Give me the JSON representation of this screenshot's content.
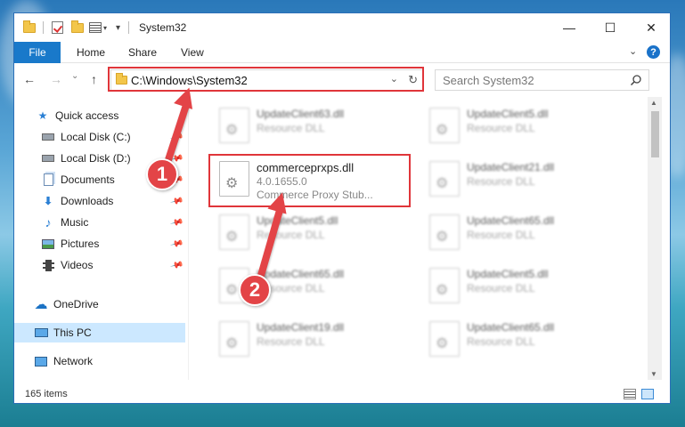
{
  "window": {
    "title": "System32",
    "controls": {
      "minimize": "—",
      "maximize": "☐",
      "close": "✕"
    }
  },
  "ribbon": {
    "tabs": [
      "File",
      "Home",
      "Share",
      "View"
    ],
    "expand_icon": "chevron-down-icon",
    "help_icon": "?"
  },
  "navigation": {
    "back": "←",
    "forward": "→",
    "recent": "⌄",
    "up": "↑",
    "address": "C:\\Windows\\System32",
    "search_placeholder": "Search System32"
  },
  "sidebar": {
    "items": [
      {
        "label": "Quick access",
        "icon": "star-icon",
        "pinned": false
      },
      {
        "label": "Local Disk (C:)",
        "icon": "drive-icon",
        "pinned": true
      },
      {
        "label": "Local Disk (D:)",
        "icon": "drive-icon",
        "pinned": true
      },
      {
        "label": "Documents",
        "icon": "documents-icon",
        "pinned": true
      },
      {
        "label": "Downloads",
        "icon": "download-icon",
        "pinned": true
      },
      {
        "label": "Music",
        "icon": "music-icon",
        "pinned": true
      },
      {
        "label": "Pictures",
        "icon": "pictures-icon",
        "pinned": true
      },
      {
        "label": "Videos",
        "icon": "videos-icon",
        "pinned": true
      },
      {
        "label": "OneDrive",
        "icon": "cloud-icon",
        "pinned": false
      },
      {
        "label": "This PC",
        "icon": "computer-icon",
        "pinned": false,
        "selected": true
      },
      {
        "label": "Network",
        "icon": "network-icon",
        "pinned": false
      }
    ]
  },
  "files": [
    {
      "name": "UpdateClient63.dll",
      "line2": "Resource DLL"
    },
    {
      "name": "UpdateClient5.dll",
      "line2": "Resource DLL"
    },
    {
      "name": "commerceprxps.dll",
      "line2": "4.0.1655.0",
      "line3": "Commerce Proxy Stub...",
      "highlighted": true
    },
    {
      "name": "UpdateClient21.dll",
      "line2": "Resource DLL"
    },
    {
      "name": "UpdateClient5.dll",
      "line2": "Resource DLL"
    },
    {
      "name": "UpdateClient65.dll",
      "line2": "Resource DLL"
    },
    {
      "name": "UpdateClient65.dll",
      "line2": "Resource DLL"
    },
    {
      "name": "UpdateClient5.dll",
      "line2": "Resource DLL"
    },
    {
      "name": "UpdateClient19.dll",
      "line2": "Resource DLL"
    },
    {
      "name": "UpdateClient65.dll",
      "line2": "Resource DLL"
    }
  ],
  "status": {
    "item_count": "165 items"
  },
  "annotations": {
    "step1": "1",
    "step2": "2",
    "color": "#e34447"
  }
}
